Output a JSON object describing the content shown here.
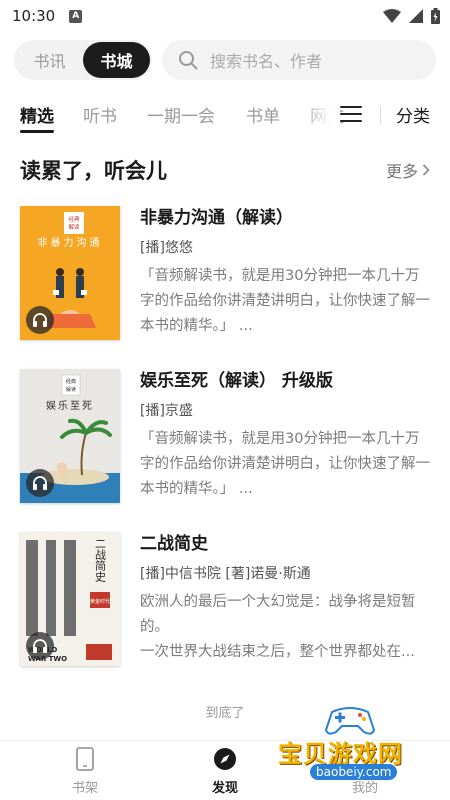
{
  "status_bar": {
    "time": "10:30",
    "notification_glyph": "A"
  },
  "top_bar": {
    "segment": [
      {
        "label": "书讯",
        "active": false
      },
      {
        "label": "书城",
        "active": true
      }
    ],
    "search_placeholder": "搜索书名、作者"
  },
  "tabs": {
    "items": [
      {
        "label": "精选",
        "active": true
      },
      {
        "label": "听书",
        "active": false
      },
      {
        "label": "一期一会",
        "active": false
      },
      {
        "label": "书单",
        "active": false
      },
      {
        "label": "网文",
        "active": false
      }
    ],
    "category_label": "分类"
  },
  "section": {
    "title": "读累了，听会儿",
    "more_label": "更多"
  },
  "books": [
    {
      "title": "非暴力沟通（解读）",
      "author_line": "[播]悠悠",
      "description": "「音频解读书，就是用30分钟把一本几十万字的作品给你讲清楚讲明白，让你快速了解一本书的精华。」 ...",
      "cover": {
        "tag": "经典解读",
        "title": "非暴力沟通",
        "bg": "#f5a623"
      }
    },
    {
      "title": "娱乐至死（解读） 升级版",
      "author_line": "[播]京盛",
      "description": "「音频解读书，就是用30分钟把一本几十万字的作品给你讲清楚讲明白，让你快速了解一本书的精华。」 ...",
      "cover": {
        "tag": "经典解读",
        "title": "娱乐至死",
        "bg": "#e9e7e3"
      }
    },
    {
      "title": "二战简史",
      "author_line": "[播]中信书院 [著]诺曼·斯通",
      "description": "欧洲人的最后一个大幻觉是：战争将是短暂的。\n一次世界大战结束之后，整个世界都处在...",
      "cover": {
        "tag": "二战简史",
        "subtitle": "黄金时代",
        "bottom": "WORLD WAR TWO",
        "bg": "#f4f1ea"
      }
    }
  ],
  "end_text": "到底了",
  "bottom_nav": [
    {
      "label": "书架",
      "icon": "phone-bookshelf-icon",
      "active": false
    },
    {
      "label": "发现",
      "icon": "compass-icon",
      "active": true
    },
    {
      "label": "我的",
      "icon": "profile-icon",
      "active": false
    }
  ],
  "watermark": {
    "text": "宝贝游戏网",
    "url": "baobeiy.com"
  }
}
